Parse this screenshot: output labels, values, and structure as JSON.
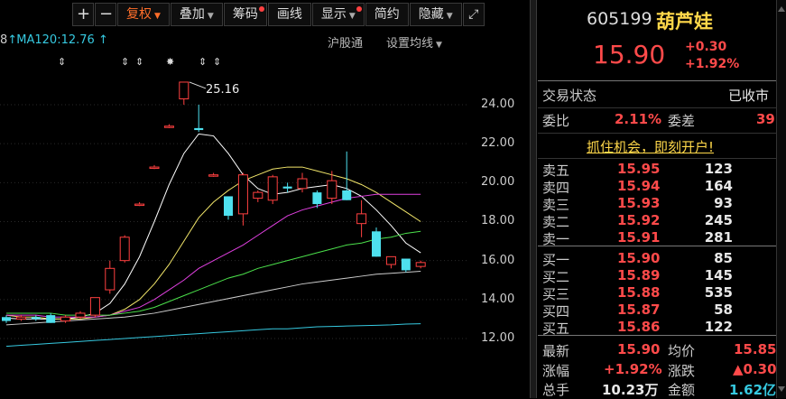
{
  "toolbar": {
    "zoom_in": "+",
    "zoom_out": "−",
    "adjust": "复权",
    "overlay": "叠加",
    "chips": "筹码",
    "draw": "画线",
    "display": "显示",
    "simple": "简约",
    "hide": "隐藏",
    "fullscreen_icon": "expand-icon"
  },
  "indicator": {
    "ma_prefix": "8",
    "ma120": "MA120:12.76",
    "hsgt": "沪股通",
    "set_ma": "设置均线"
  },
  "markers": [
    "⇕",
    "⇕",
    "⇕",
    "✸",
    "⇕",
    "⇕"
  ],
  "chart_data": {
    "type": "candlestick",
    "price_ticks": [
      "24.00",
      "22.00",
      "20.00",
      "18.00",
      "16.00",
      "14.00",
      "12.00"
    ],
    "ylim": [
      11.6,
      25.4
    ],
    "peak_label": "25.16",
    "candles": [
      {
        "o": 13.1,
        "c": 12.9,
        "h": 13.2,
        "l": 12.8
      },
      {
        "o": 13.0,
        "c": 13.1,
        "h": 13.2,
        "l": 12.9
      },
      {
        "o": 13.1,
        "c": 13.0,
        "h": 13.2,
        "l": 12.9
      },
      {
        "o": 13.2,
        "c": 12.8,
        "h": 13.3,
        "l": 12.8
      },
      {
        "o": 12.9,
        "c": 13.1,
        "h": 13.2,
        "l": 12.8
      },
      {
        "o": 13.1,
        "c": 13.3,
        "h": 13.4,
        "l": 13.0
      },
      {
        "o": 13.2,
        "c": 14.1,
        "h": 14.1,
        "l": 13.1
      },
      {
        "o": 14.5,
        "c": 15.6,
        "h": 16.0,
        "l": 14.3
      },
      {
        "o": 16.0,
        "c": 17.2,
        "h": 17.3,
        "l": 15.9
      },
      {
        "o": 18.9,
        "c": 18.9,
        "h": 19.0,
        "l": 18.8
      },
      {
        "o": 20.8,
        "c": 20.8,
        "h": 20.9,
        "l": 20.7
      },
      {
        "o": 22.9,
        "c": 22.9,
        "h": 23.0,
        "l": 22.8
      },
      {
        "o": 24.3,
        "c": 25.16,
        "h": 25.16,
        "l": 24.0
      },
      {
        "o": 22.8,
        "c": 22.7,
        "h": 24.0,
        "l": 22.6
      },
      {
        "o": 20.4,
        "c": 20.4,
        "h": 20.5,
        "l": 20.3
      },
      {
        "o": 19.3,
        "c": 18.3,
        "h": 19.3,
        "l": 18.1
      },
      {
        "o": 18.4,
        "c": 20.4,
        "h": 20.5,
        "l": 17.8
      },
      {
        "o": 19.2,
        "c": 19.5,
        "h": 19.6,
        "l": 19.0
      },
      {
        "o": 19.1,
        "c": 20.3,
        "h": 20.4,
        "l": 18.9
      },
      {
        "o": 19.8,
        "c": 19.7,
        "h": 20.0,
        "l": 19.5
      },
      {
        "o": 19.7,
        "c": 20.2,
        "h": 20.5,
        "l": 19.5
      },
      {
        "o": 19.5,
        "c": 18.9,
        "h": 19.6,
        "l": 18.7
      },
      {
        "o": 19.2,
        "c": 20.1,
        "h": 20.6,
        "l": 18.9
      },
      {
        "o": 19.6,
        "c": 19.1,
        "h": 21.6,
        "l": 19.1
      },
      {
        "o": 17.9,
        "c": 18.4,
        "h": 19.1,
        "l": 17.2
      },
      {
        "o": 17.5,
        "c": 16.2,
        "h": 17.7,
        "l": 16.2
      },
      {
        "o": 15.8,
        "c": 16.2,
        "h": 16.2,
        "l": 15.6
      },
      {
        "o": 16.1,
        "c": 15.5,
        "h": 16.1,
        "l": 15.4
      },
      {
        "o": 15.7,
        "c": 15.9,
        "h": 16.0,
        "l": 15.6
      }
    ],
    "ma_lines": [
      {
        "color": "#ffffff",
        "values": [
          13.05,
          13.0,
          13.0,
          13.0,
          13.0,
          13.1,
          13.3,
          13.8,
          14.8,
          16.2,
          18.0,
          19.9,
          21.5,
          22.5,
          22.4,
          21.5,
          20.4,
          19.7,
          19.4,
          19.5,
          19.7,
          19.8,
          19.9,
          19.7,
          19.3,
          18.6,
          17.8,
          16.9,
          16.4
        ]
      },
      {
        "color": "#f2e66a",
        "values": [
          13.2,
          13.1,
          13.1,
          13.0,
          13.0,
          13.0,
          13.1,
          13.2,
          13.5,
          14.0,
          14.8,
          15.8,
          17.0,
          18.2,
          19.0,
          19.6,
          20.1,
          20.4,
          20.7,
          20.8,
          20.8,
          20.6,
          20.4,
          20.2,
          19.9,
          19.5,
          19.0,
          18.5,
          18.0
        ]
      },
      {
        "color": "#e040e0",
        "values": [
          13.2,
          13.2,
          13.2,
          13.1,
          13.1,
          13.1,
          13.1,
          13.2,
          13.4,
          13.6,
          14.0,
          14.5,
          15.0,
          15.6,
          16.0,
          16.4,
          16.8,
          17.3,
          17.8,
          18.3,
          18.6,
          18.8,
          19.0,
          19.2,
          19.3,
          19.4,
          19.4,
          19.4,
          19.4
        ]
      },
      {
        "color": "#4be04b",
        "values": [
          13.3,
          13.3,
          13.3,
          13.3,
          13.2,
          13.2,
          13.2,
          13.2,
          13.3,
          13.4,
          13.6,
          13.9,
          14.2,
          14.5,
          14.8,
          15.1,
          15.3,
          15.6,
          15.8,
          16.0,
          16.2,
          16.4,
          16.6,
          16.8,
          16.9,
          17.1,
          17.2,
          17.4,
          17.5
        ]
      },
      {
        "color": "#cccccc",
        "values": [
          12.7,
          12.75,
          12.8,
          12.85,
          12.9,
          12.95,
          13.0,
          13.05,
          13.1,
          13.2,
          13.3,
          13.45,
          13.6,
          13.75,
          13.9,
          14.05,
          14.2,
          14.35,
          14.5,
          14.65,
          14.8,
          14.9,
          15.0,
          15.1,
          15.2,
          15.3,
          15.35,
          15.4,
          15.45
        ]
      },
      {
        "color": "#36c9e0",
        "values": [
          11.6,
          11.65,
          11.7,
          11.75,
          11.8,
          11.85,
          11.9,
          11.95,
          12.0,
          12.05,
          12.1,
          12.15,
          12.2,
          12.25,
          12.3,
          12.35,
          12.4,
          12.45,
          12.5,
          12.5,
          12.55,
          12.6,
          12.62,
          12.64,
          12.66,
          12.68,
          12.7,
          12.74,
          12.76
        ]
      }
    ]
  },
  "quote": {
    "code": "605199",
    "name": "葫芦娃",
    "price": "15.90",
    "change": "+0.30",
    "change_pct": "+1.92%",
    "status_label": "交易状态",
    "status_value": "已收市",
    "weibi_label": "委比",
    "weibi_value": "2.11%",
    "weicha_label": "委差",
    "weicha_value": "39",
    "promo": "抓住机会，即刻开户!",
    "asks": [
      {
        "label": "卖五",
        "price": "15.95",
        "vol": "123"
      },
      {
        "label": "卖四",
        "price": "15.94",
        "vol": "164"
      },
      {
        "label": "卖三",
        "price": "15.93",
        "vol": "93"
      },
      {
        "label": "卖二",
        "price": "15.92",
        "vol": "245"
      },
      {
        "label": "卖一",
        "price": "15.91",
        "vol": "281"
      }
    ],
    "bids": [
      {
        "label": "买一",
        "price": "15.90",
        "vol": "85"
      },
      {
        "label": "买二",
        "price": "15.89",
        "vol": "145"
      },
      {
        "label": "买三",
        "price": "15.88",
        "vol": "535"
      },
      {
        "label": "买四",
        "price": "15.87",
        "vol": "58"
      },
      {
        "label": "买五",
        "price": "15.86",
        "vol": "122"
      }
    ],
    "latest_label": "最新",
    "latest_value": "15.90",
    "avg_label": "均价",
    "avg_value": "15.85",
    "pct_label": "涨幅",
    "pct_value": "+1.92%",
    "chg_label": "涨跌",
    "chg_value": "▲0.30",
    "vol_label": "总手",
    "vol_value": "10.23万",
    "amt_label": "金额",
    "amt_value": "1.62亿"
  }
}
